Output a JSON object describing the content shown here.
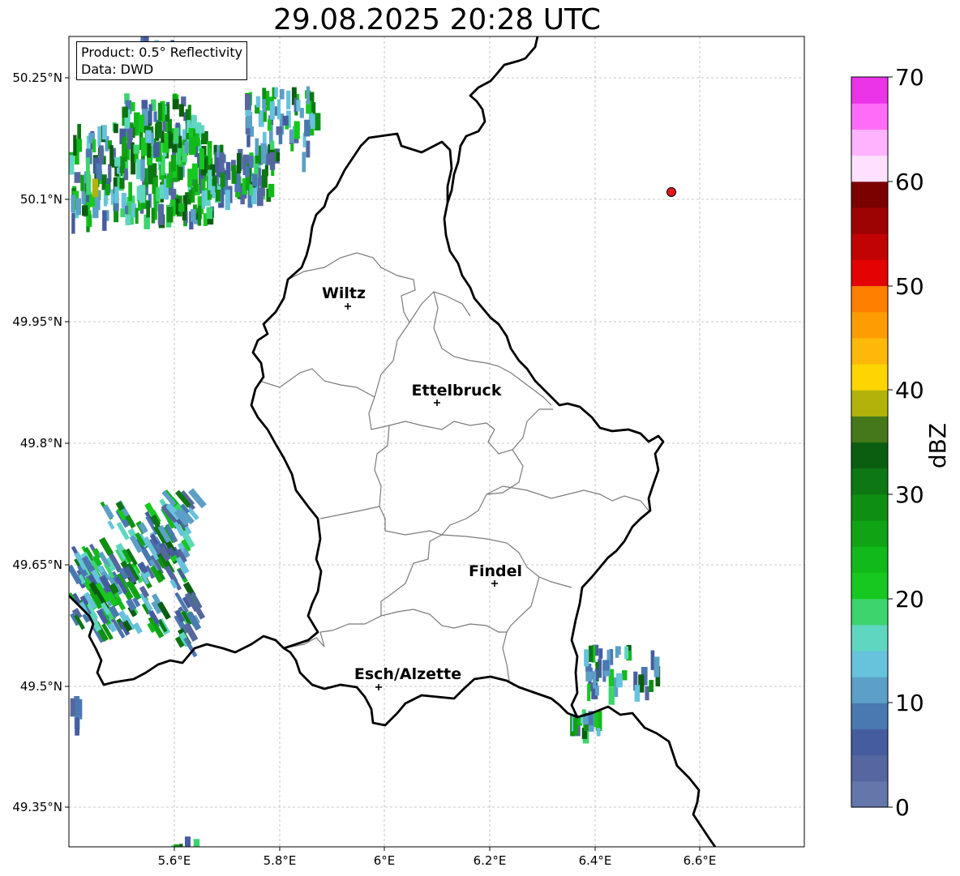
{
  "title": "29.08.2025 20:28 UTC",
  "info_box": {
    "product_line": "Product: 0.5° Reflectivity",
    "data_line": "Data: DWD"
  },
  "axes": {
    "lat_ticks": [
      "50.25°N",
      "50.1°N",
      "49.95°N",
      "49.8°N",
      "49.65°N",
      "49.5°N",
      "49.35°N"
    ],
    "lon_ticks": [
      "5.6°E",
      "5.8°E",
      "6°E",
      "6.2°E",
      "6.4°E",
      "6.6°E"
    ],
    "grid": true
  },
  "cities": [
    {
      "name": "Wiltz"
    },
    {
      "name": "Ettelbruck"
    },
    {
      "name": "Findel"
    },
    {
      "name": "Esch/Alzette"
    }
  ],
  "radar_marker": {
    "color": "#e31a1c"
  },
  "colorbar": {
    "label": "dBZ",
    "min": 0,
    "max": 70,
    "ticks": [
      "0",
      "10",
      "20",
      "30",
      "40",
      "50",
      "60",
      "70"
    ],
    "colors": [
      "#6577aa",
      "#55679e",
      "#455d9f",
      "#4a78b0",
      "#5c9fc7",
      "#67c2dc",
      "#5fd6c0",
      "#3cd46c",
      "#16c81f",
      "#12b91a",
      "#10a314",
      "#0e8f12",
      "#0c7713",
      "#0b5e10",
      "#45781a",
      "#b1b30a",
      "#ffd500",
      "#fdb80a",
      "#fe9c04",
      "#ff7f00",
      "#e30303",
      "#c10303",
      "#9d0302",
      "#7a0100",
      "#ffe1ff",
      "#feb3ff",
      "#ff6cf7",
      "#eb34e8"
    ]
  }
}
